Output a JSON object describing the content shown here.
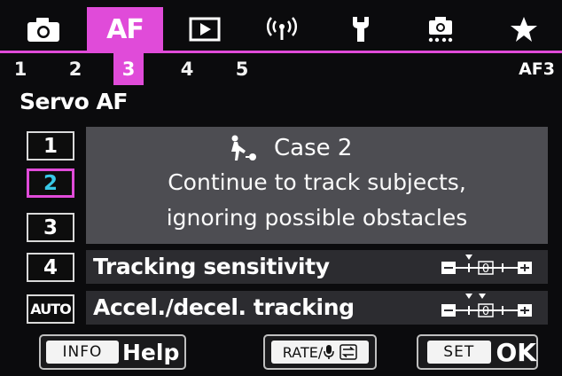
{
  "tabs": [
    {
      "name": "shooting",
      "icon": "camera-icon"
    },
    {
      "name": "af",
      "label": "AF",
      "active": true
    },
    {
      "name": "playback",
      "icon": "playback-icon"
    },
    {
      "name": "wireless",
      "icon": "wireless-icon"
    },
    {
      "name": "setup",
      "icon": "wrench-icon"
    },
    {
      "name": "custom",
      "icon": "custom-functions-icon"
    },
    {
      "name": "my-menu",
      "icon": "star-icon"
    }
  ],
  "subpages": {
    "numbers": [
      "1",
      "2",
      "3",
      "4",
      "5"
    ],
    "active_index": 2,
    "code": "AF3"
  },
  "section_title": "Servo AF",
  "cases": {
    "buttons": [
      "1",
      "2",
      "3",
      "4",
      "AUTO"
    ],
    "selected_index": 1
  },
  "description": {
    "icon": "case-2-icon",
    "case_label": "Case 2",
    "line1": "Continue to track subjects,",
    "line2": "ignoring possible obstacles"
  },
  "params": [
    {
      "label": "Tracking sensitivity",
      "value": 0,
      "default_marker": 0,
      "scale_zero_label": "0"
    },
    {
      "label": "Accel./decel. tracking",
      "value": 0,
      "default_marker": 0,
      "scale_zero_label": "0"
    }
  ],
  "bottom": {
    "info_key": "INFO",
    "help_label": "Help",
    "rate_key": "RATE/",
    "set_key": "SET",
    "ok_label": "OK"
  },
  "colors": {
    "accent": "#e04bd9",
    "selected_text": "#38c8e6"
  }
}
